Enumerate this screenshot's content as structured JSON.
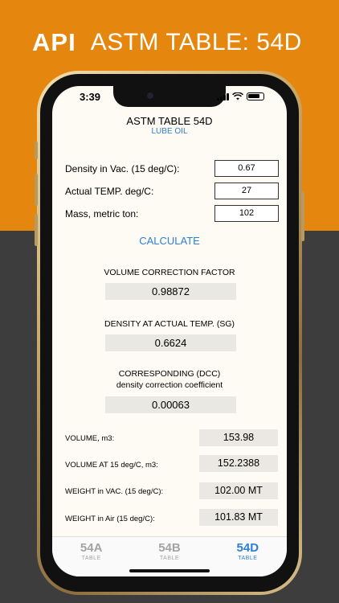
{
  "banner": {
    "api": "API",
    "title": "ASTM TABLE: 54D"
  },
  "status_bar": {
    "time": "3:39"
  },
  "header": {
    "title": "ASTM TABLE 54D",
    "subtitle": "LUBE OIL"
  },
  "inputs": {
    "density_label": "Density in Vac. (15 deg/C):",
    "density_value": "0.67",
    "temp_label": "Actual TEMP. deg/C:",
    "temp_value": "27",
    "mass_label": "Mass, metric ton:",
    "mass_value": "102"
  },
  "calculate_label": "CALCULATE",
  "results": {
    "vcf_label": "VOLUME CORRECTION FACTOR",
    "vcf_value": "0.98872",
    "density_actual_label": "DENSITY AT ACTUAL TEMP. (SG)",
    "density_actual_value": "0.6624",
    "dcc_label_1": "CORRESPONDING (DCC)",
    "dcc_label_2": "density correction coefficient",
    "dcc_value": "0.00063",
    "volume_label": "VOLUME, m3:",
    "volume_value": "153.98",
    "volume15_label": "VOLUME AT 15 deg/C, m3:",
    "volume15_value": "152.2388",
    "weight_vac_label": "WEIGHT in VAC. (15 deg/C):",
    "weight_vac_value": "102.00 MT",
    "weight_air_label": "WEIGHT in Air (15 deg/C):",
    "weight_air_value": "101.83 MT"
  },
  "tabs": [
    {
      "label": "54A",
      "sub": "TABLE"
    },
    {
      "label": "54B",
      "sub": "TABLE"
    },
    {
      "label": "54D",
      "sub": "TABLE"
    }
  ],
  "colors": {
    "banner_orange": "#e5860f",
    "accent_blue": "#2d7fd3",
    "background_dark": "#3d3d3d"
  }
}
